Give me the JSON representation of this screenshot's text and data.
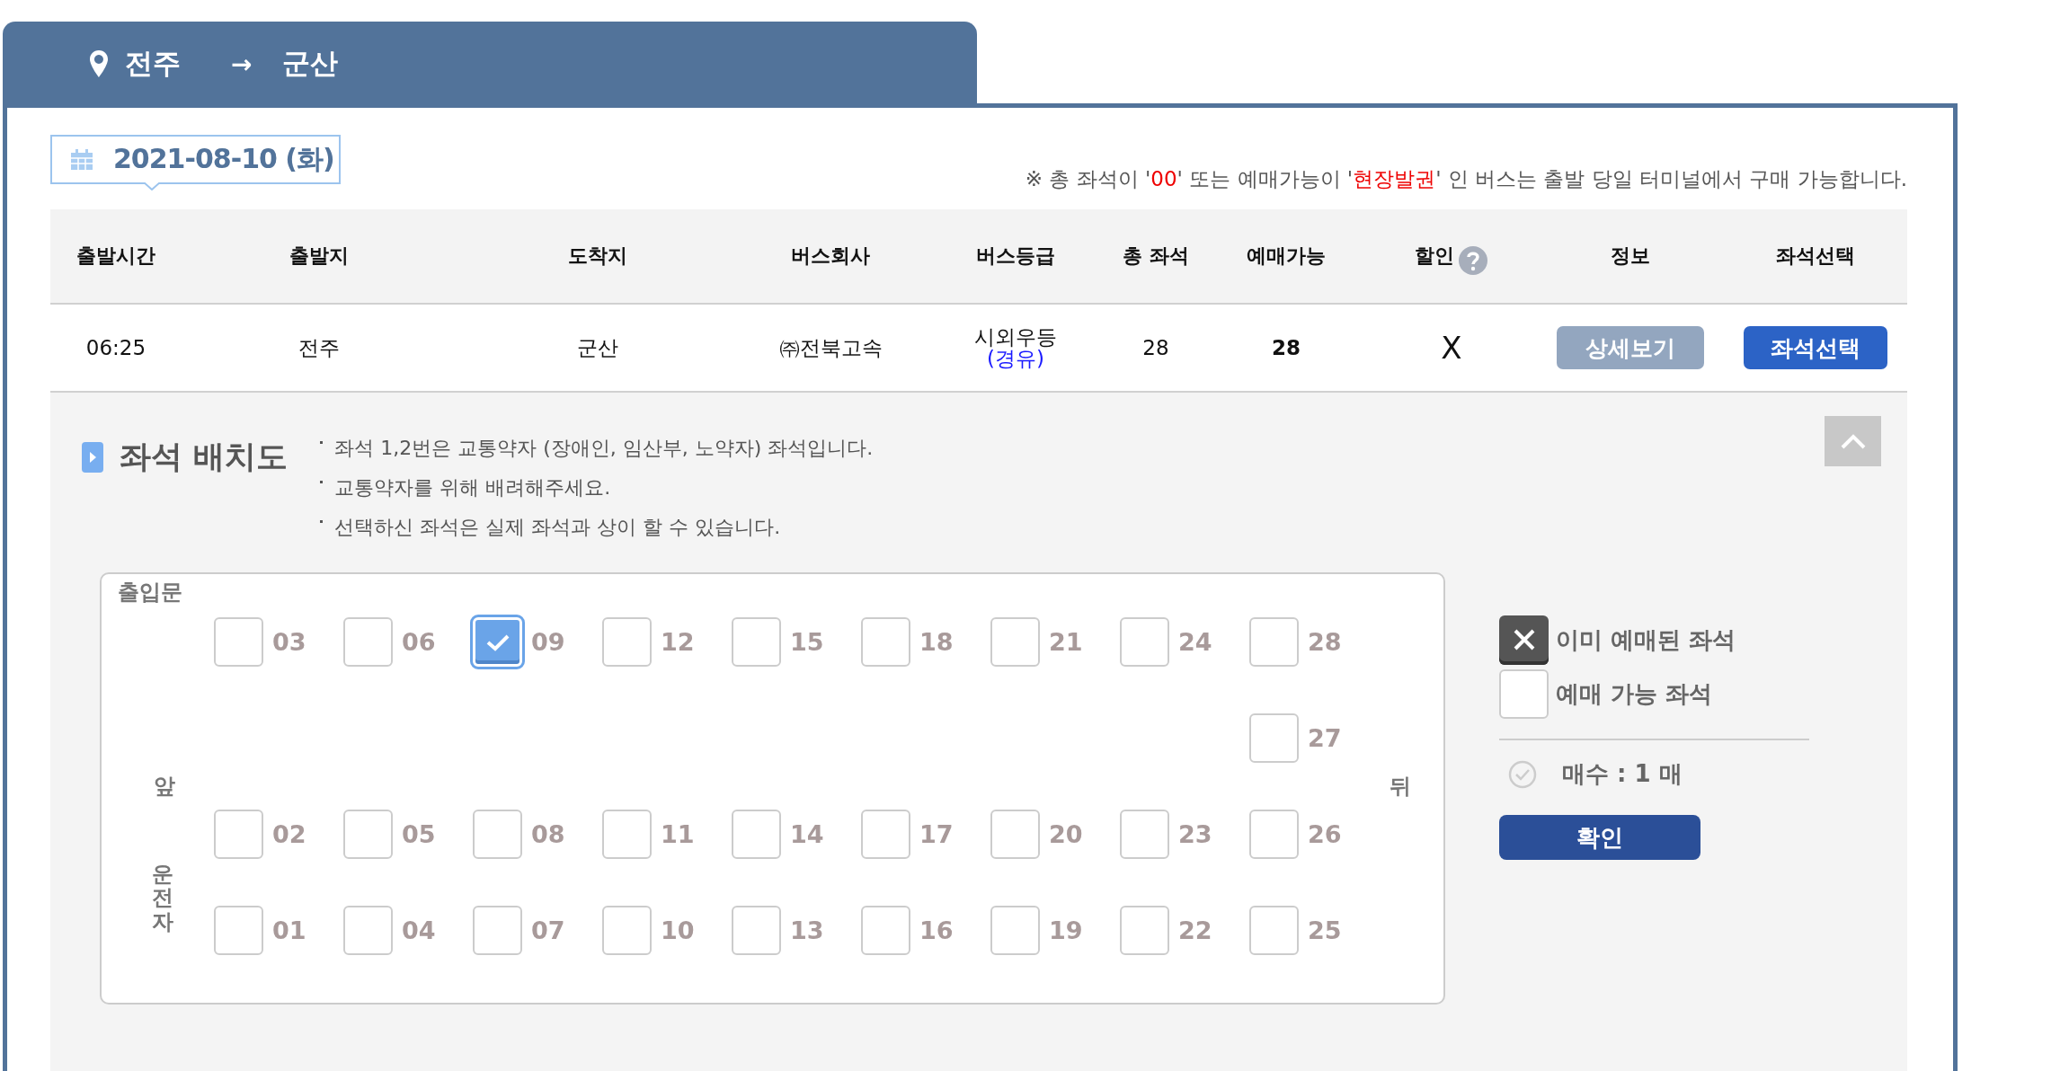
{
  "route": {
    "origin": "전주",
    "arrow": "→",
    "destination": "군산"
  },
  "date": "2021-08-10 (화)",
  "notice": [
    {
      "text": "※ 총 좌석이 '",
      "highlight": false
    },
    {
      "text": "00",
      "highlight": true
    },
    {
      "text": "' 또는 예매가능이 '",
      "highlight": false
    },
    {
      "text": "현장발권",
      "highlight": true
    },
    {
      "text": "' 인 버스는 출발 당일 터미널에서 구매 가능합니다.",
      "highlight": false
    }
  ],
  "table": {
    "columns": [
      {
        "label": "출발시간",
        "help": false
      },
      {
        "label": "출발지",
        "help": false
      },
      {
        "label": "도착지",
        "help": false
      },
      {
        "label": "버스회사",
        "help": false
      },
      {
        "label": "버스등급",
        "help": false
      },
      {
        "label": "총 좌석",
        "help": false
      },
      {
        "label": "예매가능",
        "help": false
      },
      {
        "label": "할인",
        "help": true
      },
      {
        "label": "정보",
        "help": false
      },
      {
        "label": "좌석선택",
        "help": false
      }
    ],
    "rows": [
      {
        "departure_time": "06:25",
        "origin": "전주",
        "destination": "군산",
        "company": "㈜전북고속",
        "grade": "시외우등",
        "grade_note": "(경유)",
        "total_seats": "28",
        "available_seats": "28",
        "discount": "X",
        "detail_button": "상세보기",
        "select_button": "좌석선택"
      }
    ]
  },
  "seat_section": {
    "title": "좌석 배치도",
    "notes": [
      "좌석 1,2번은 교통약자 (장애인, 임산부, 노약자) 좌석입니다.",
      "교통약자를 위해 배려해주세요.",
      "선택하신 좌석은 실제 좌석과 상이 할 수 있습니다."
    ]
  },
  "seat_map": {
    "door_label": "출입문",
    "front_label": "앞",
    "driver_label": "운전자",
    "rear_label": "뒤",
    "rows": [
      {
        "seats": [
          {
            "number": "03",
            "selected": false
          },
          {
            "number": "06",
            "selected": false
          },
          {
            "number": "09",
            "selected": true
          },
          {
            "number": "12",
            "selected": false
          },
          {
            "number": "15",
            "selected": false
          },
          {
            "number": "18",
            "selected": false
          },
          {
            "number": "21",
            "selected": false
          },
          {
            "number": "24",
            "selected": false
          },
          {
            "number": "28",
            "selected": false
          }
        ]
      },
      {
        "seats": [
          {
            "number": "02",
            "selected": false
          },
          {
            "number": "05",
            "selected": false
          },
          {
            "number": "08",
            "selected": false
          },
          {
            "number": "11",
            "selected": false
          },
          {
            "number": "14",
            "selected": false
          },
          {
            "number": "17",
            "selected": false
          },
          {
            "number": "20",
            "selected": false
          },
          {
            "number": "23",
            "selected": false
          },
          {
            "number": "26",
            "selected": false
          }
        ]
      },
      {
        "seats": [
          {
            "number": "01",
            "selected": false
          },
          {
            "number": "04",
            "selected": false
          },
          {
            "number": "07",
            "selected": false
          },
          {
            "number": "10",
            "selected": false
          },
          {
            "number": "13",
            "selected": false
          },
          {
            "number": "16",
            "selected": false
          },
          {
            "number": "19",
            "selected": false
          },
          {
            "number": "22",
            "selected": false
          },
          {
            "number": "25",
            "selected": false
          }
        ]
      }
    ],
    "rear_seat": {
      "number": "27",
      "selected": false
    }
  },
  "legend": [
    {
      "kind": "reserved",
      "label": "이미 예매된 좌석"
    },
    {
      "kind": "available",
      "label": "예매 가능 좌석"
    }
  ],
  "count": "매수 : 1 매",
  "confirm_button": "확인"
}
